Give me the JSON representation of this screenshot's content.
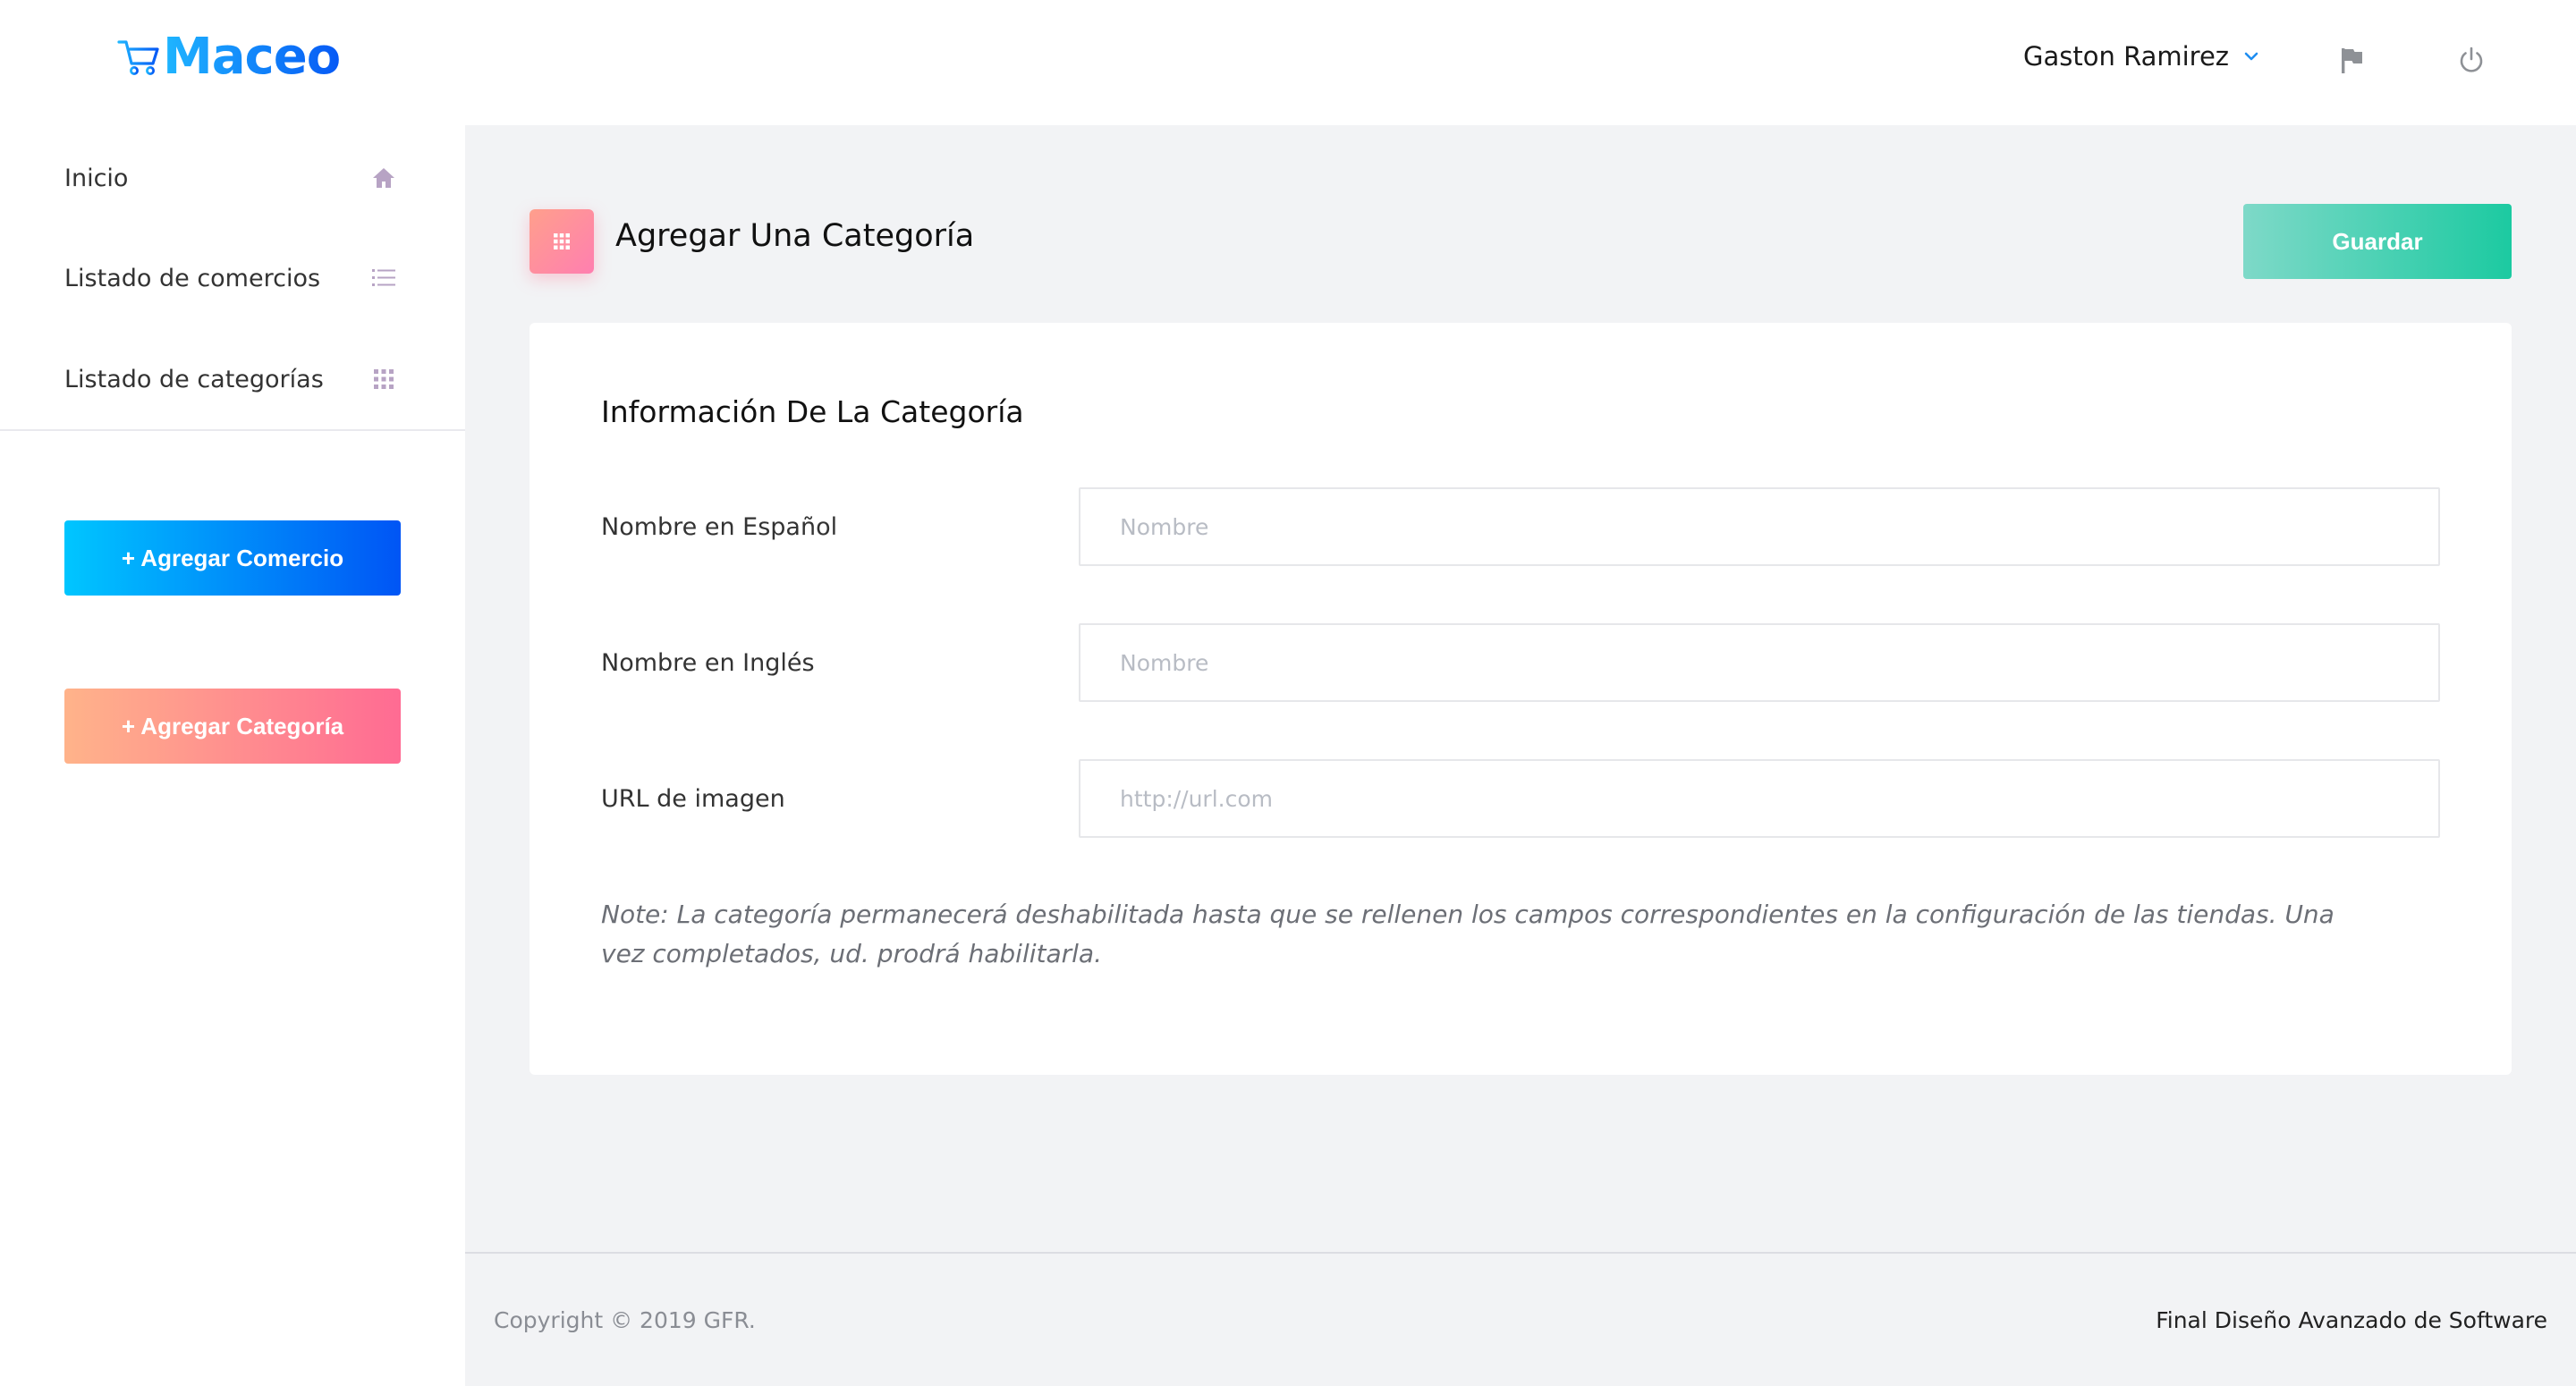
{
  "header": {
    "logo_text": "Maceo",
    "user_name": "Gaston Ramirez",
    "icons": [
      "cart-icon",
      "chevron-down-icon",
      "flag-icon",
      "power-icon"
    ]
  },
  "sidebar": {
    "items": [
      {
        "label": "Inicio",
        "icon": "home-icon"
      },
      {
        "label": "Listado de comercios",
        "icon": "list-icon"
      },
      {
        "label": "Listado de categorías",
        "icon": "grid-icon"
      }
    ],
    "add_comercio_label": "+ Agregar Comercio",
    "add_categoria_label": "+ Agregar Categoría"
  },
  "page": {
    "title": "Agregar Una Categoría",
    "save_label": "Guardar"
  },
  "form": {
    "title": "Información De La Categoría",
    "fields": [
      {
        "label": "Nombre en Español",
        "placeholder": "Nombre",
        "value": ""
      },
      {
        "label": "Nombre en Inglés",
        "placeholder": "Nombre",
        "value": ""
      },
      {
        "label": "URL de imagen",
        "placeholder": "http://url.com",
        "value": ""
      }
    ],
    "note": "Note: La categoría permanecerá deshabilitada hasta que se rellenen los campos correspondientes en la configuración de las tiendas. Una vez completados, ud. prodrá habilitarla."
  },
  "footer": {
    "copyright": "Copyright © 2019 GFR.",
    "right_text": "Final Diseño Avanzado de Software"
  },
  "colors": {
    "brand_blue": "#0659f5",
    "brand_cyan": "#00c6ff",
    "pink": "#ff6b93",
    "peach": "#ffb38a",
    "teal": "#1ccaa1",
    "background": "#f2f3f5",
    "icon_purple": "#b7a3c4"
  }
}
